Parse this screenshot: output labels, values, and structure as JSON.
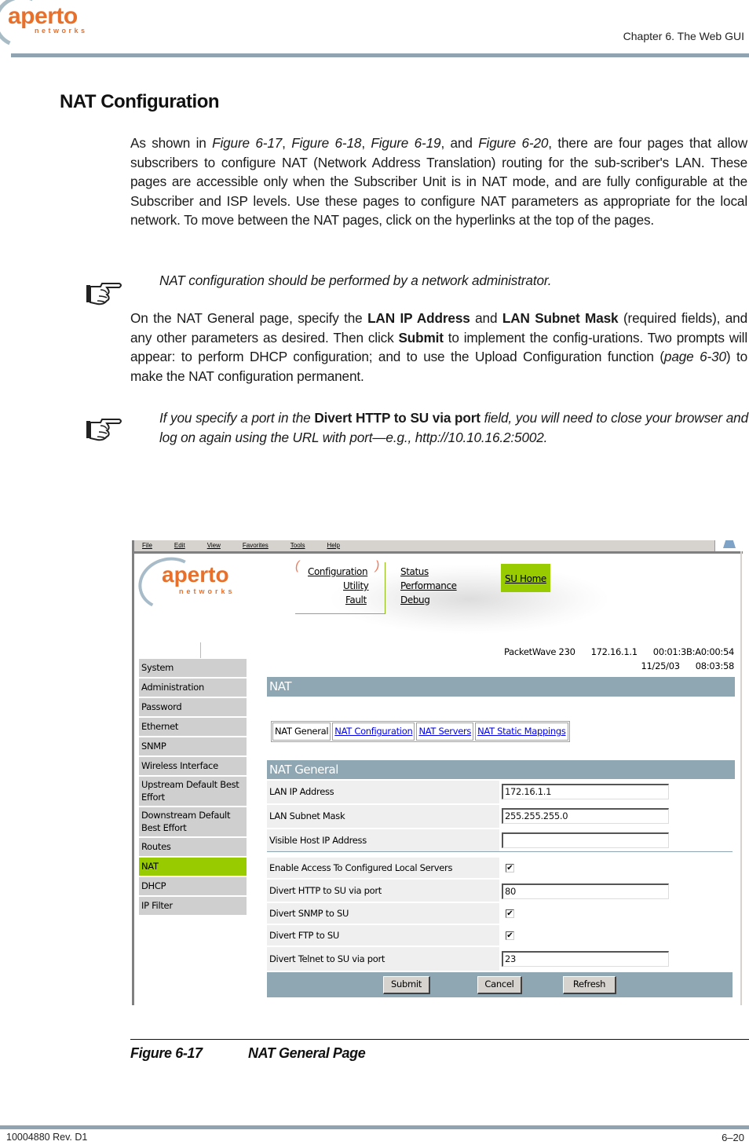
{
  "header": {
    "logo_word": "aperto",
    "logo_sub": "networks",
    "chapter": "Chapter 6.  The Web GUI"
  },
  "section_title": "NAT Configuration",
  "paragraph1": {
    "t0": "As shown in ",
    "f1": "Figure 6-17",
    "t1": ", ",
    "f2": "Figure 6-18",
    "t2": ", ",
    "f3": "Figure 6-19",
    "t3": ", and ",
    "f4": "Figure 6-20",
    "t4": ", there are four pages that allow subscribers to configure NAT (Network Address Translation) routing for the sub-scriber's LAN. These pages are accessible only when the Subscriber Unit is in NAT mode, and are fully configurable at the Subscriber and ISP levels. Use these pages to configure NAT parameters as appropriate for the local network. To move between the NAT pages, click on the hyperlinks at the top of the pages."
  },
  "note1": "NAT configuration should be performed by a network administrator.",
  "paragraph2": {
    "t0": "On the NAT General page, specify the ",
    "b1": "LAN IP Address",
    "t1": " and ",
    "b2": "LAN Subnet Mask",
    "t2": " (required fields), and any other parameters as desired. Then click ",
    "b3": "Submit",
    "t3": " to implement the config-urations. Two prompts will appear: to perform DHCP configuration; and to use the Upload Configuration function (",
    "i1": "page 6-30",
    "t4": ") to make the NAT configuration permanent."
  },
  "note2": {
    "t0": "If you specify a port in the ",
    "b1": "Divert HTTP to SU via port",
    "t1": " field, you will need to close your browser and log on again using the URL with port—e.g., http://10.10.16.2:5002."
  },
  "screenshot": {
    "menubar": [
      "File",
      "Edit",
      "View",
      "Favorites",
      "Tools",
      "Help"
    ],
    "app_logo_word": "aperto",
    "app_logo_sub": "networks",
    "nav": {
      "configuration": "Configuration",
      "utility": "Utility",
      "fault": "Fault",
      "status": "Status",
      "performance": "Performance",
      "debug": "Debug",
      "su_home": "SU Home"
    },
    "sidebar": [
      {
        "label": "System",
        "active": false
      },
      {
        "label": "Administration",
        "active": false
      },
      {
        "label": "Password",
        "active": false
      },
      {
        "label": "Ethernet",
        "active": false
      },
      {
        "label": "SNMP",
        "active": false
      },
      {
        "label": "Wireless Interface",
        "active": false
      },
      {
        "label": "Upstream Default Best Effort",
        "active": false
      },
      {
        "label": "Downstream Default Best Effort",
        "active": false
      },
      {
        "label": "Routes",
        "active": false
      },
      {
        "label": "NAT",
        "active": true
      },
      {
        "label": "DHCP",
        "active": false
      },
      {
        "label": "IP Filter",
        "active": false
      }
    ],
    "device": {
      "model": "PacketWave 230",
      "ip": "172.16.1.1",
      "mac": "00:01:3B:A0:00:54",
      "date": "11/25/03",
      "time": "08:03:58"
    },
    "page_bar": "NAT",
    "tabs": [
      {
        "label": "NAT General",
        "current": true
      },
      {
        "label": "NAT Configuration",
        "current": false
      },
      {
        "label": "NAT Servers",
        "current": false
      },
      {
        "label": "NAT Static Mappings",
        "current": false
      }
    ],
    "section_bar": "NAT General",
    "fields": {
      "lan_ip": {
        "label": "LAN IP Address",
        "value": "172.16.1.1"
      },
      "lan_mask": {
        "label": "LAN Subnet Mask",
        "value": "255.255.255.0"
      },
      "visible_host": {
        "label": "Visible Host IP Address",
        "value": ""
      },
      "enable_access": {
        "label": "Enable Access To Configured Local Servers",
        "checked": true
      },
      "divert_http": {
        "label": "Divert HTTP to SU via port",
        "value": "80"
      },
      "divert_snmp": {
        "label": "Divert SNMP to SU",
        "checked": true
      },
      "divert_ftp": {
        "label": "Divert FTP to SU",
        "checked": true
      },
      "divert_telnet": {
        "label": "Divert Telnet to SU via port",
        "value": "23"
      }
    },
    "buttons": {
      "submit": "Submit",
      "cancel": "Cancel",
      "refresh": "Refresh"
    },
    "colors": {
      "accent_green": "#99cc00",
      "bar_blue_gray": "#8fa6b3",
      "logo_orange": "#e8702a"
    }
  },
  "caption": {
    "number": "Figure 6-17",
    "title": "NAT General Page"
  },
  "footer": {
    "doc_id": "10004880 Rev. D1",
    "page": "6–20"
  }
}
